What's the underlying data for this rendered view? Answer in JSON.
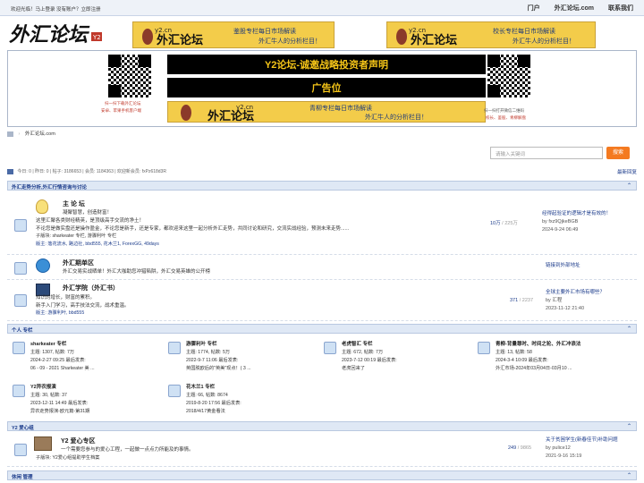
{
  "topbar": {
    "login_text": "欢迎光临！马上登录    没有账户？立即注册",
    "nav": [
      "门户",
      "外汇论坛.com",
      "联系我们"
    ]
  },
  "logo": {
    "text": "外汇论坛"
  },
  "banners": [
    {
      "brand": "y2.cn",
      "line1": "鉴股专栏每日市场解读",
      "line2": "外汇牛人的分析栏目！"
    },
    {
      "brand": "y2.cn",
      "line1": "校长专栏每日市场解读",
      "line2": "外汇牛人的分析栏目！"
    }
  ],
  "ad": {
    "left_qr_caption": "扫一扫下载外汇论坛",
    "left_qr_caption2": "安卓、苹果手机客户端",
    "right_qr_caption": "扫一扫打开微信二维码",
    "right_qr_caption2": "校长、鉴股、青柳解盘",
    "headline": "Y2论坛-诚邀战略投资者声明",
    "slot": "广告位",
    "banner_brand": "y2.cn",
    "banner_line1": "青柳专栏每日市场解读",
    "banner_line2": "外汇牛人的分析栏目！"
  },
  "breadcrumb": {
    "home_icon": "home-icon",
    "text": "外汇论坛.com"
  },
  "search": {
    "placeholder": "请输入关键词",
    "button": "搜索"
  },
  "stats": {
    "text": "今日: 0 | 昨日: 0 | 帖子: 3186653 | 会员: 1184363 | 欢迎新会员: fxPz618d3R"
  },
  "latest_label": "最新回复",
  "categories": [
    {
      "title": "外汇走势分析,外汇行情咨询与讨论",
      "forums": [
        {
          "name": "主 论 坛",
          "desc1": "凝聚智慧，创造财富！",
          "desc2": "这里汇聚各类财经精英，是顶级高手交流的净土！",
          "desc3": "不论您是做实盘还是操作盈金，不论您是新手，还是专家，都欢迎来这里一起分析外汇走势，共同讨论和研究，交流实战经验，预测未来走势......",
          "sub": "子版块: sharkeater 专栏, 游骤利叶 专栏",
          "mods": "版主: 落花流水, 路边社, bbd555, 花木兰1, ForexGG, 49days",
          "count": "10万",
          "count_sub": "/ 225万",
          "last_title": "经得起验证的逻辑才是有效的！",
          "last_by": "by fxz9QjkeBGB",
          "last_time": "2024-9-24 06:49"
        },
        {
          "name": "外汇期单区",
          "desc1": "外汇交易实战晒单！外汇大咖助您冲猎陷阱，外汇交易英雄的公开榜",
          "last_title": "链接到外部地址"
        },
        {
          "name": "外汇学院（外汇书）",
          "desc1": "知识的增长，财富的累积。",
          "desc2": "新手入门学习，高手技法交流，战术重温。",
          "mods": "版主: 游骤利叶, bbd555",
          "count": "371",
          "count_sub": "/ 2237",
          "last_title": "全球主要外汇市场有哪些？",
          "last_by": "by 汇程",
          "last_time": "2023-11-12 21:40"
        }
      ]
    },
    {
      "title": "个人 专栏",
      "cells": [
        {
          "name": "sharkeater 专栏",
          "l1": "主题: 1307, 帖数: 7万",
          "l2": "2024-2-27 09:25 最后发表:",
          "l3": "06 - 09 - 2021 Sharkeater 美 ..."
        },
        {
          "name": "游骤利叶 专栏",
          "l1": "主题: 1774, 帖数: 5万",
          "l2": "2022-9-7 11:06 最后发表:",
          "l3": "英国脱欧后的\"英美\"现点！( 3 ..."
        },
        {
          "name": "老虎智汇 专栏",
          "l1": "主题: 672, 帖数: 7万",
          "l2": "2023-7-12 00:19 最后发表:",
          "l3": "老虎回来了"
        },
        {
          "name": "青柳-背量尊时、时间之轮、外汇冲浪法",
          "l1": "主题: 13, 帖数: 58",
          "l2": "2024-3-4 10:09 最后发表:",
          "l3": "外汇市场-2024年03月04日-03月10 ..."
        },
        {
          "name": "Y2异农报演",
          "l1": "主题: 30, 帖数: 37",
          "l2": "2023-12-11 14:49 最后发表:",
          "l3": "异农走势报演-欧元篇-第31期"
        },
        {
          "name": "花木兰1 专栏",
          "l1": "主题: 66, 帖数: 8674",
          "l2": "2019-8-20 17:56 最后发表:",
          "l3": "2018/4/17黄金看法"
        }
      ]
    },
    {
      "title": "Y2 爱心组",
      "forums": [
        {
          "name": "Y2 爱心专区",
          "desc1": "一个需要您参与的爱心工程，一起做一点点力所能及的事情。",
          "sub": "子版块: Y2爱心组提助学生档案",
          "count": "249",
          "count_sub": "/ 9865",
          "last_title": "关于贫困学生(新春佳节)补助问题",
          "last_by": "by pulice12",
          "last_time": "2021-9-16 15:19"
        }
      ]
    },
    {
      "title": "休闲 管理"
    }
  ]
}
